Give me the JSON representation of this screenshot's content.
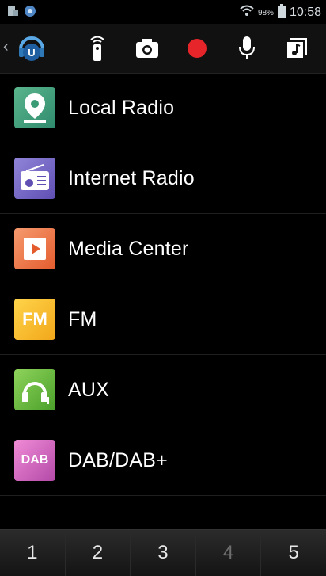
{
  "status_bar": {
    "battery_percent": "98%",
    "time": "10:58",
    "icons": [
      "storage-icon",
      "app-notification-icon",
      "wifi-icon",
      "battery-icon"
    ]
  },
  "toolbar": {
    "back_glyph": "‹",
    "buttons": [
      "remote-icon",
      "camera-icon",
      "record-icon",
      "microphone-icon",
      "music-library-icon"
    ],
    "record_color": "#e5252a"
  },
  "menu": {
    "items": [
      {
        "label": "Local Radio",
        "icon": "location-pin-icon"
      },
      {
        "label": "Internet Radio",
        "icon": "radio-icon"
      },
      {
        "label": "Media Center",
        "icon": "play-icon"
      },
      {
        "label": "FM",
        "icon": "fm-icon",
        "icon_text": "FM"
      },
      {
        "label": "AUX",
        "icon": "headphones-icon"
      },
      {
        "label": "DAB/DAB+",
        "icon": "dab-icon",
        "icon_text": "DAB"
      }
    ]
  },
  "presets": {
    "items": [
      "1",
      "2",
      "3",
      "4",
      "5"
    ],
    "disabled_index": 3
  }
}
